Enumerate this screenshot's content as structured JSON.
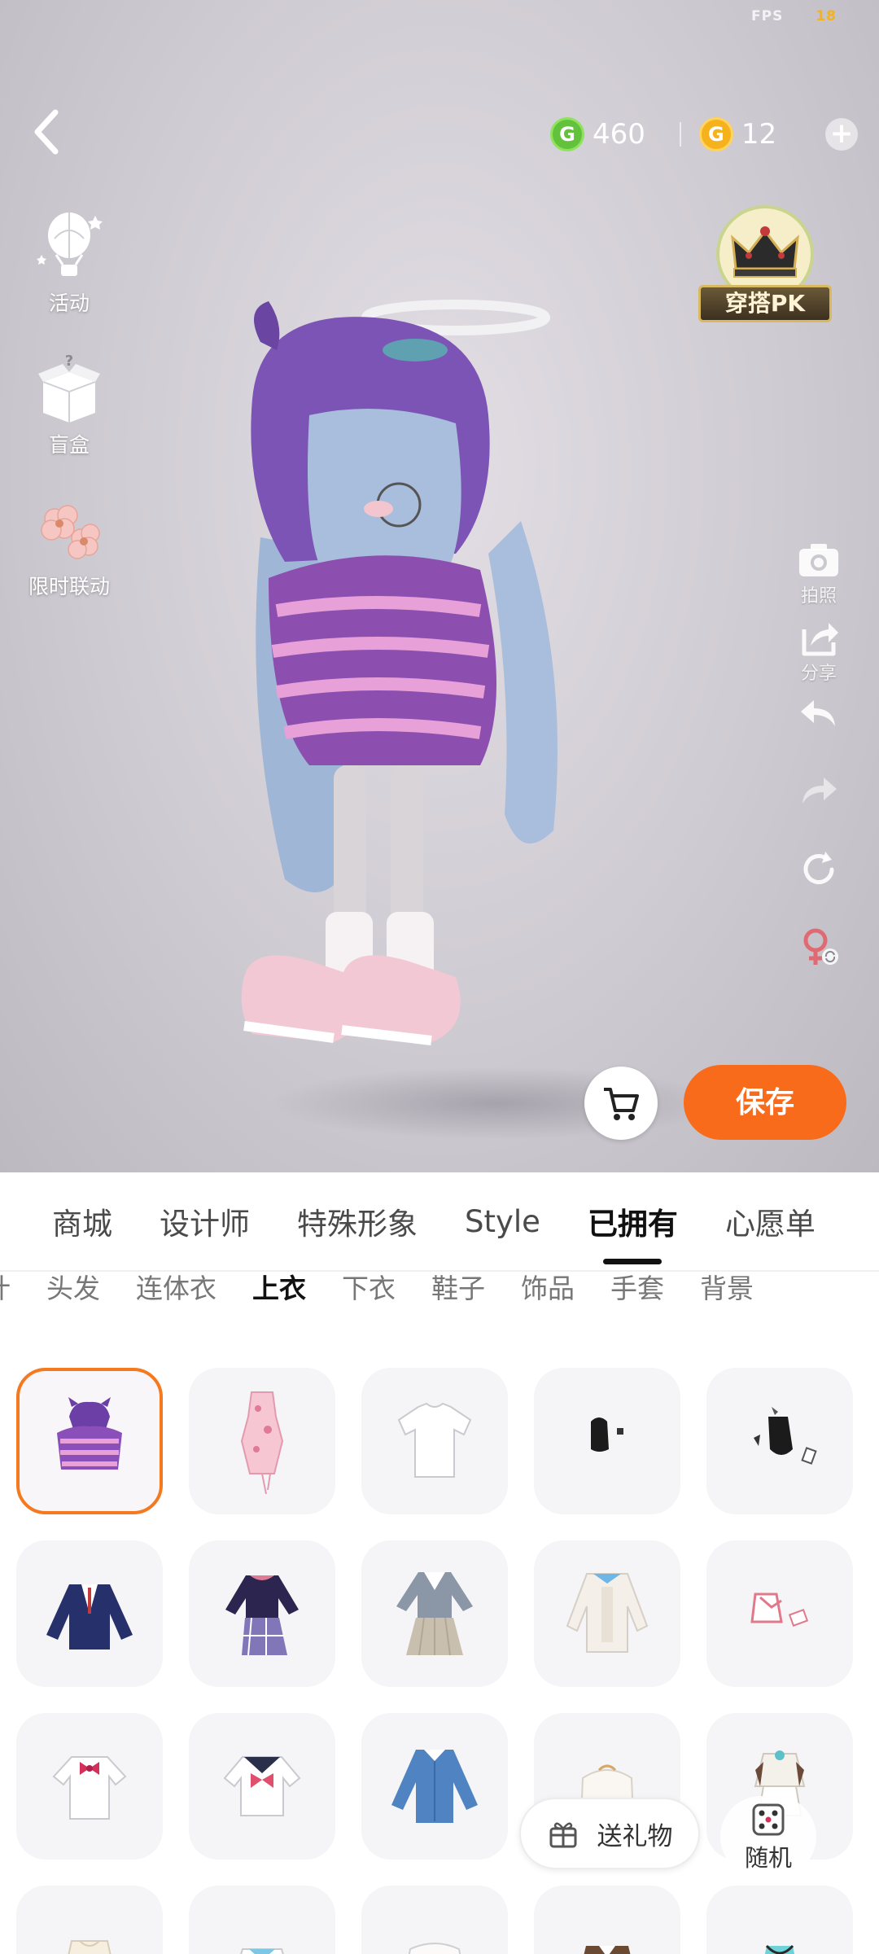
{
  "status": {
    "fps_label": "FPS",
    "fps_value": "18"
  },
  "currency": {
    "green_icon_letter": "G",
    "green_amount": "460",
    "gold_icon_letter": "G",
    "gold_amount": "12"
  },
  "left_menu": [
    {
      "label": "活动",
      "icon": "balloon-icon"
    },
    {
      "label": "盲盒",
      "icon": "blind-box-icon"
    },
    {
      "label": "限时联动",
      "icon": "sakura-icon"
    }
  ],
  "pk_badge": {
    "label": "穿搭PK"
  },
  "right_tools": [
    {
      "label": "拍照",
      "icon": "camera-icon"
    },
    {
      "label": "分享",
      "icon": "share-icon"
    },
    {
      "label": "",
      "icon": "undo-icon"
    },
    {
      "label": "",
      "icon": "redo-icon"
    },
    {
      "label": "",
      "icon": "reset-icon"
    },
    {
      "label": "",
      "icon": "gender-switch-icon"
    }
  ],
  "actions": {
    "save_label": "保存"
  },
  "main_tabs": [
    "商城",
    "设计师",
    "特殊形象",
    "Style",
    "已拥有",
    "心愿单"
  ],
  "main_tab_active": "已拥有",
  "sub_tabs": [
    "计",
    "头发",
    "连体衣",
    "上衣",
    "下衣",
    "鞋子",
    "饰品",
    "手套",
    "背景"
  ],
  "sub_tab_active": "上衣",
  "floating": {
    "gift_label": "送礼物",
    "random_label": "随机"
  },
  "colors": {
    "accent": "#f86b1b",
    "selected_border": "#f5791f",
    "green_coin": "#62c23b",
    "gold_coin": "#f5b21d"
  }
}
